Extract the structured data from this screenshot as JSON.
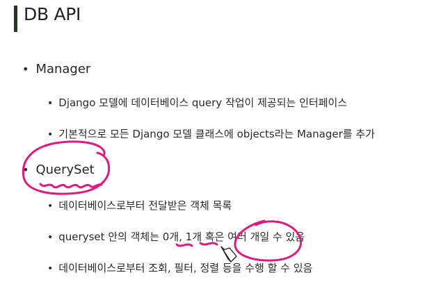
{
  "slide": {
    "title": "DB API",
    "sections": [
      {
        "heading": "Manager",
        "items": [
          "Django 모델에 데이터베이스 query 작업이 제공되는 인터페이스",
          "기본적으로 모든 Django 모델 클래스에 objects라는 Manager를 추가"
        ]
      },
      {
        "heading": "QuerySet",
        "items": [
          "데이터베이스로부터 전달받은 객체 목록",
          "queryset 안의 객체는 0개, 1개 혹은 여러 개일 수 있음",
          "데이터베이스로부터 조회, 필터, 정렬 등을 수행 할 수 있음"
        ]
      }
    ],
    "bullet_glyph": "•"
  },
  "colors": {
    "title_accent": "#1f3a1f",
    "annotation_ink": "#e0197d"
  },
  "icons": {
    "cursor": "pencil-cursor-icon"
  }
}
